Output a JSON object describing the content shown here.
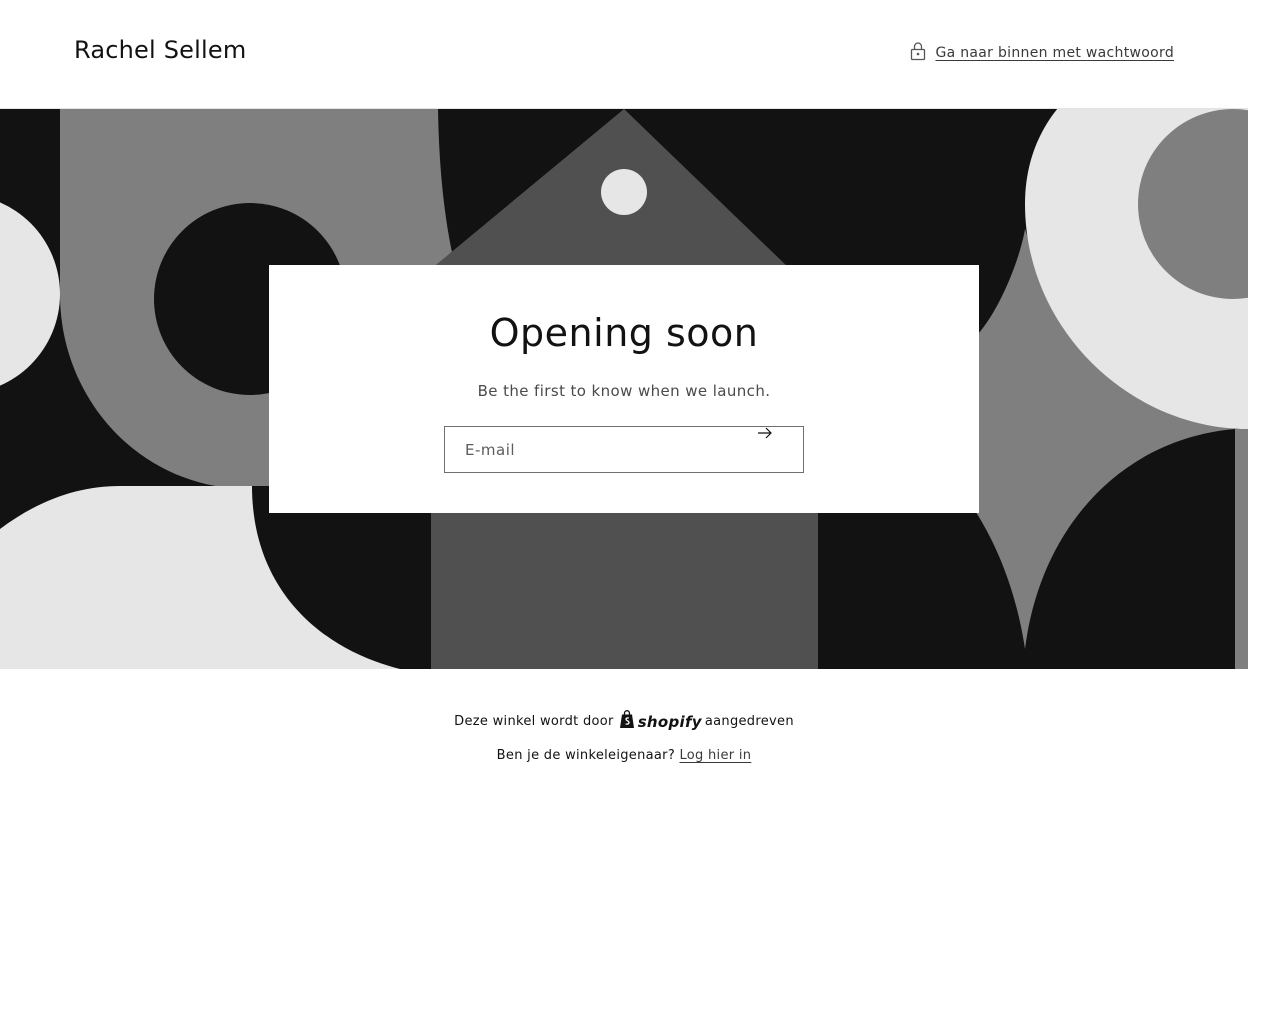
{
  "header": {
    "store_name": "Rachel Sellem",
    "password_link": "Ga naar binnen met wachtwoord",
    "lock_icon": "lock-icon"
  },
  "main": {
    "title": "Opening soon",
    "subtitle": "Be the first to know when we launch.",
    "email": {
      "placeholder": "E-mail",
      "value": "",
      "submit_icon": "arrow-right-icon"
    }
  },
  "footer": {
    "powered_prefix": "Deze winkel wordt door",
    "shopify": "shopify",
    "powered_suffix": "aangedreven",
    "owner_question": "Ben je de winkeleigenaar?",
    "login_link": "Log hier in"
  },
  "colors": {
    "black": "#121212",
    "dark_gray": "#505050",
    "mid_gray": "#7f7f7f",
    "light_gray": "#e6e6e6",
    "white": "#ffffff"
  }
}
